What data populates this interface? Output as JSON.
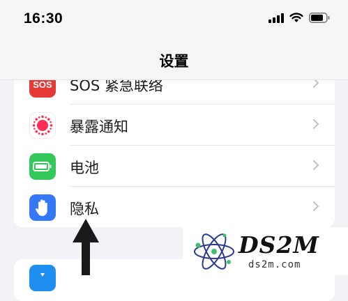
{
  "status_bar": {
    "time": "16:30"
  },
  "nav": {
    "title": "设置"
  },
  "settings": {
    "items": [
      {
        "label": "SOS 紧急联络",
        "icon": "sos-icon",
        "icon_text": "SOS",
        "color": "#e53935"
      },
      {
        "label": "暴露通知",
        "icon": "exposure-notification-icon",
        "color": "#ff2d55"
      },
      {
        "label": "电池",
        "icon": "battery-icon",
        "color": "#34c759"
      },
      {
        "label": "隐私",
        "icon": "hand-icon",
        "color": "#3478f6"
      }
    ]
  },
  "watermark": {
    "brand": "DS2M",
    "url": "ds2m.com"
  }
}
